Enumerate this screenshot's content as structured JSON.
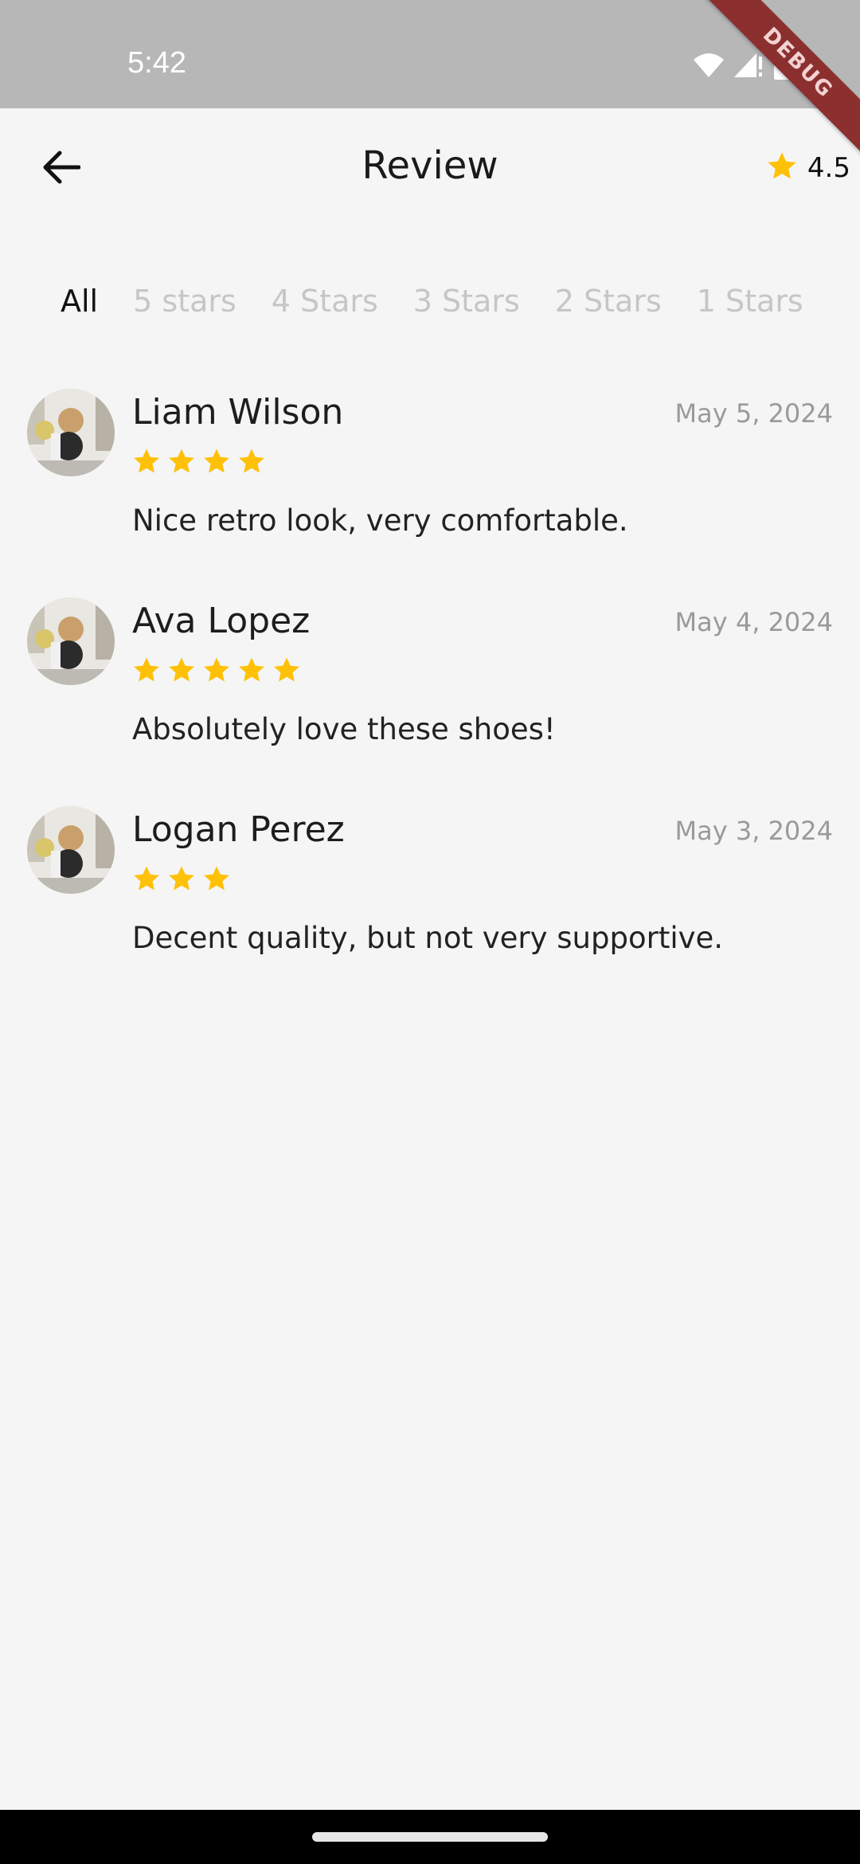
{
  "status_bar": {
    "time": "5:42"
  },
  "debug_label": "DEBUG",
  "header": {
    "title": "Review",
    "rating": "4.5"
  },
  "tabs": [
    {
      "label": "All",
      "active": true
    },
    {
      "label": "5 stars",
      "active": false
    },
    {
      "label": "4 Stars",
      "active": false
    },
    {
      "label": "3 Stars",
      "active": false
    },
    {
      "label": "2 Stars",
      "active": false
    },
    {
      "label": "1 Stars",
      "active": false
    }
  ],
  "reviews": [
    {
      "name": "Liam Wilson",
      "date": "May 5, 2024",
      "stars": 4,
      "text": "Nice retro look, very comfortable."
    },
    {
      "name": "Ava Lopez",
      "date": "May 4, 2024",
      "stars": 5,
      "text": "Absolutely love these shoes!"
    },
    {
      "name": "Logan Perez",
      "date": "May 3, 2024",
      "stars": 3,
      "text": "Decent quality, but not very supportive."
    }
  ],
  "colors": {
    "star": "#FFC107",
    "background": "#F5F5F5",
    "status_bar": "#B7B7B7",
    "inactive_tab": "#C6C6C6"
  },
  "icons": {
    "back": "arrow-left-icon",
    "rating": "star-icon",
    "wifi": "wifi-icon",
    "signal": "signal-icon",
    "battery": "battery-icon"
  }
}
